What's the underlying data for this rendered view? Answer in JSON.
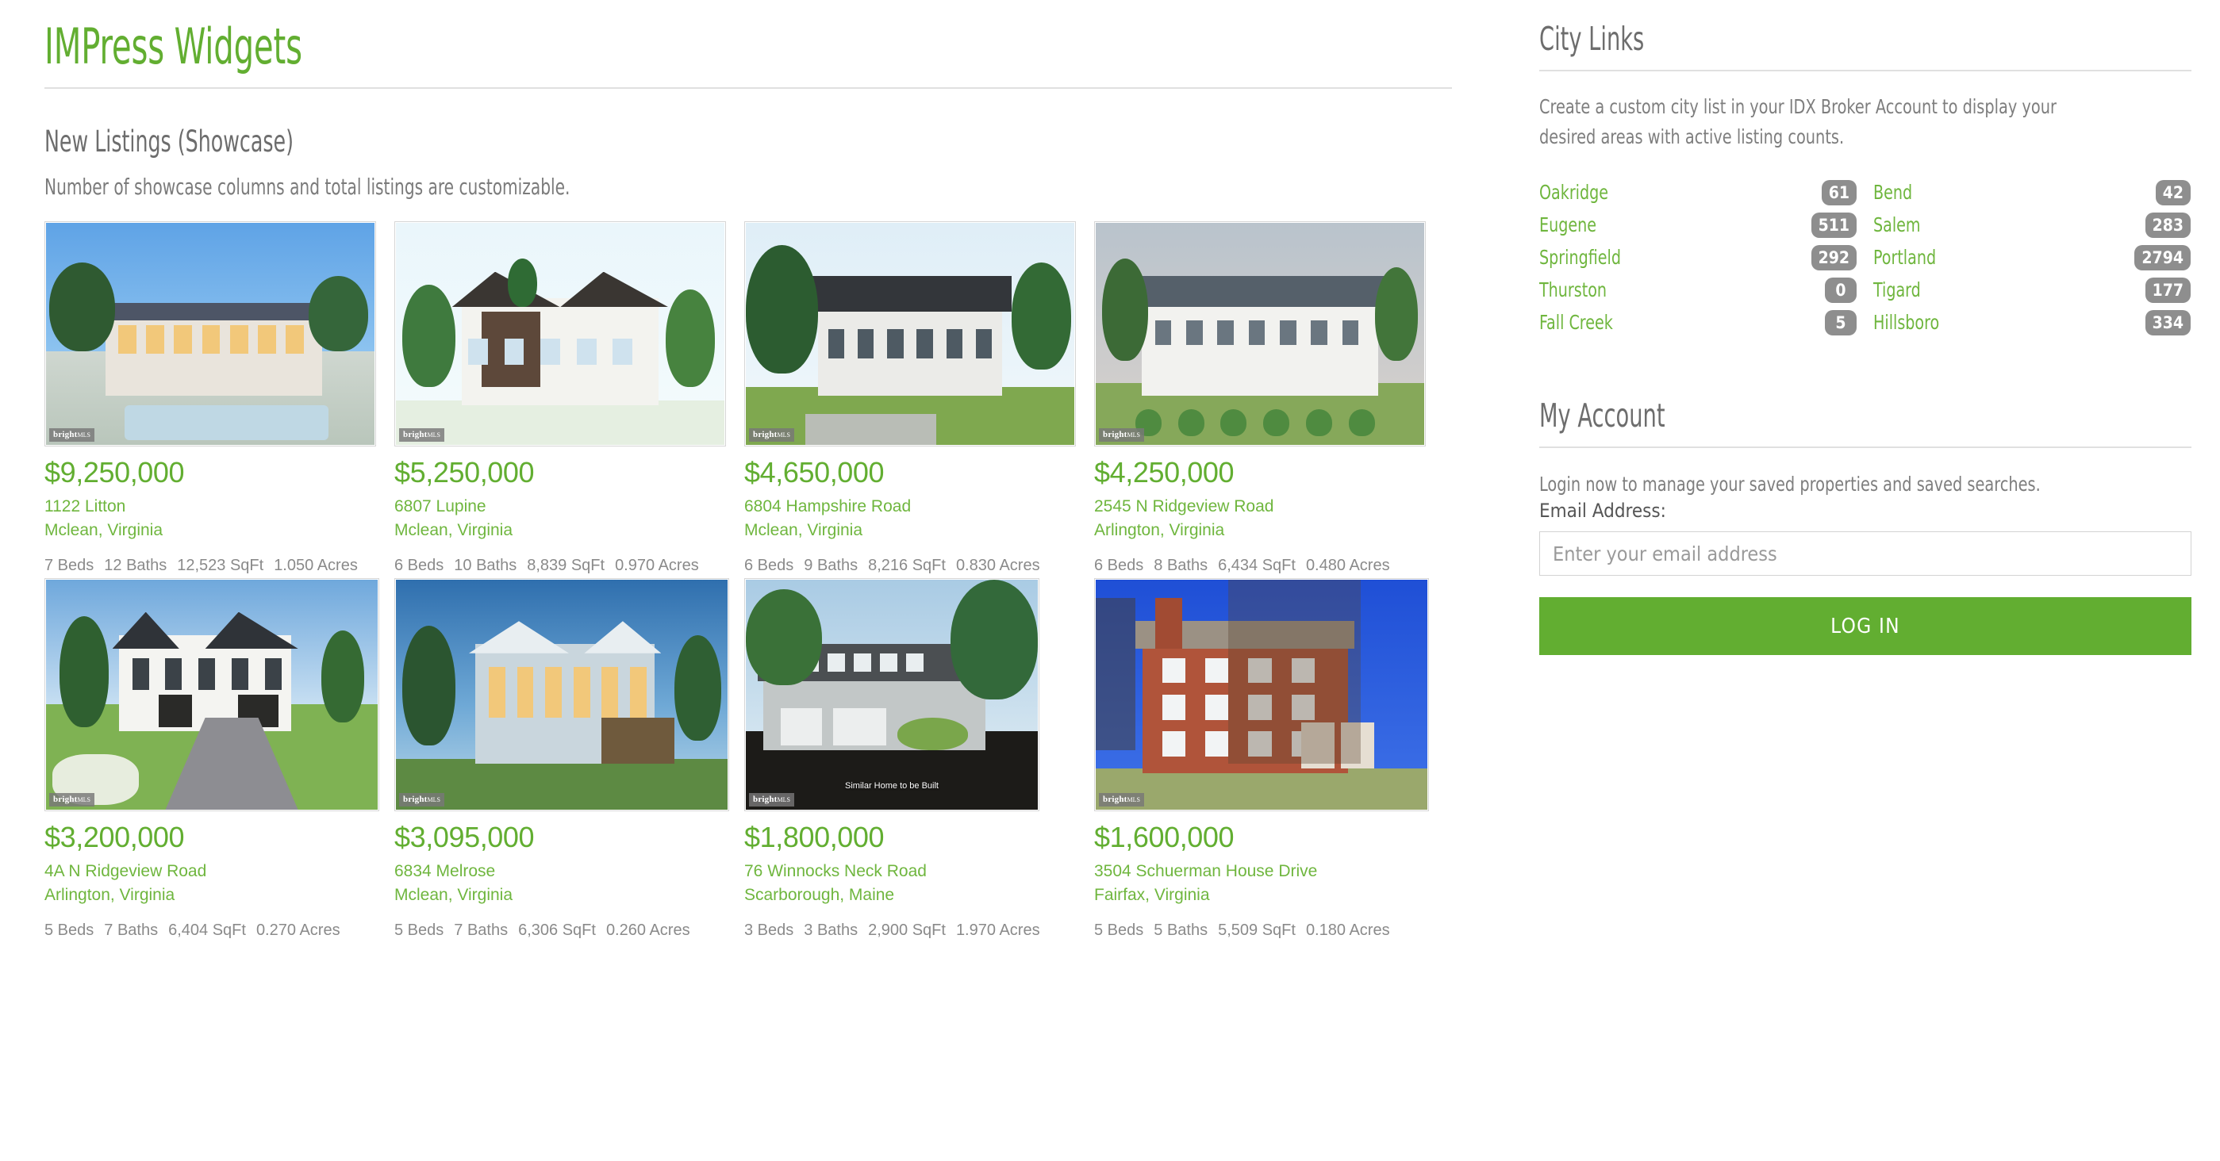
{
  "brand": {
    "title": "IMPress Widgets"
  },
  "main": {
    "section_title": "New Listings (Showcase)",
    "section_subtitle": "Number of showcase columns and total listings are customizable.",
    "mls_watermark_prefix": "bright",
    "mls_watermark_suffix": "MLS",
    "listings": [
      {
        "price": "$9,250,000",
        "address": "1122 Litton",
        "city": "Mclean, Virginia",
        "beds": "7 Beds",
        "baths": "12 Baths",
        "sqft": "12,523 SqFt",
        "acres": "1.050 Acres",
        "image_alt": "modern-luxury-home-at-dusk-with-pool"
      },
      {
        "price": "$5,250,000",
        "address": "6807 Lupine",
        "city": "Mclean, Virginia",
        "beds": "6 Beds",
        "baths": "10 Baths",
        "sqft": "8,839 SqFt",
        "acres": "0.970 Acres",
        "image_alt": "white-and-dark-brick-two-story-house-rendering"
      },
      {
        "price": "$4,650,000",
        "address": "6804 Hampshire Road",
        "city": "Mclean, Virginia",
        "beds": "6 Beds",
        "baths": "9 Baths",
        "sqft": "8,216 SqFt",
        "acres": "0.830 Acres",
        "image_alt": "dark-roof-modern-farmhouse-rendering"
      },
      {
        "price": "$4,250,000",
        "address": "2545 N Ridgeview Road",
        "city": "Arlington, Virginia",
        "beds": "6 Beds",
        "baths": "8 Baths",
        "sqft": "6,434 SqFt",
        "acres": "0.480 Acres",
        "image_alt": "white-house-with-three-car-garage"
      },
      {
        "price": "$3,200,000",
        "address": "4A N Ridgeview Road",
        "city": "Arlington, Virginia",
        "beds": "5 Beds",
        "baths": "7 Baths",
        "sqft": "6,404 SqFt",
        "acres": "0.270 Acres",
        "image_alt": "white-gabled-house-with-paver-driveway"
      },
      {
        "price": "$3,095,000",
        "address": "6834 Melrose",
        "city": "Mclean, Virginia",
        "beds": "5 Beds",
        "baths": "7 Baths",
        "sqft": "6,306 SqFt",
        "acres": "0.260 Acres",
        "image_alt": "modern-home-lit-at-twilight"
      },
      {
        "price": "$1,800,000",
        "address": "76 Winnocks Neck Road",
        "city": "Scarborough, Maine",
        "beds": "3 Beds",
        "baths": "3 Baths",
        "sqft": "2,900 SqFt",
        "acres": "1.970 Acres",
        "image_alt": "gray-cape-style-home-with-garage",
        "overlay_note": "Similar Home to be Built"
      },
      {
        "price": "$1,600,000",
        "address": "3504 Schuerman House Drive",
        "city": "Fairfax, Virginia",
        "beds": "5 Beds",
        "baths": "5 Baths",
        "sqft": "5,509 SqFt",
        "acres": "0.180 Acres",
        "image_alt": "brick-colonial-home-with-bare-trees"
      }
    ]
  },
  "sidebar": {
    "city_links": {
      "title": "City Links",
      "description": "Create a custom city list in your IDX Broker Account to display your desired areas with active listing counts.",
      "items": [
        {
          "name": "Oakridge",
          "count": "61"
        },
        {
          "name": "Bend",
          "count": "42"
        },
        {
          "name": "Eugene",
          "count": "511"
        },
        {
          "name": "Salem",
          "count": "283"
        },
        {
          "name": "Springfield",
          "count": "292"
        },
        {
          "name": "Portland",
          "count": "2794"
        },
        {
          "name": "Thurston",
          "count": "0"
        },
        {
          "name": "Tigard",
          "count": "177"
        },
        {
          "name": "Fall Creek",
          "count": "5"
        },
        {
          "name": "Hillsboro",
          "count": "334"
        }
      ]
    },
    "my_account": {
      "title": "My Account",
      "description": "Login now to manage your saved properties and saved searches.",
      "email_label": "Email Address:",
      "email_value": "",
      "email_placeholder": "Enter your email address",
      "login_label": "LOG IN"
    }
  },
  "colors": {
    "brand_green": "#62ae31",
    "link_green": "#6fb63e",
    "heading_gray": "#6d6d6d",
    "body_gray": "#7e7e7e",
    "badge_gray": "#8e8e8e",
    "rule_gray": "#e0e0e0"
  }
}
